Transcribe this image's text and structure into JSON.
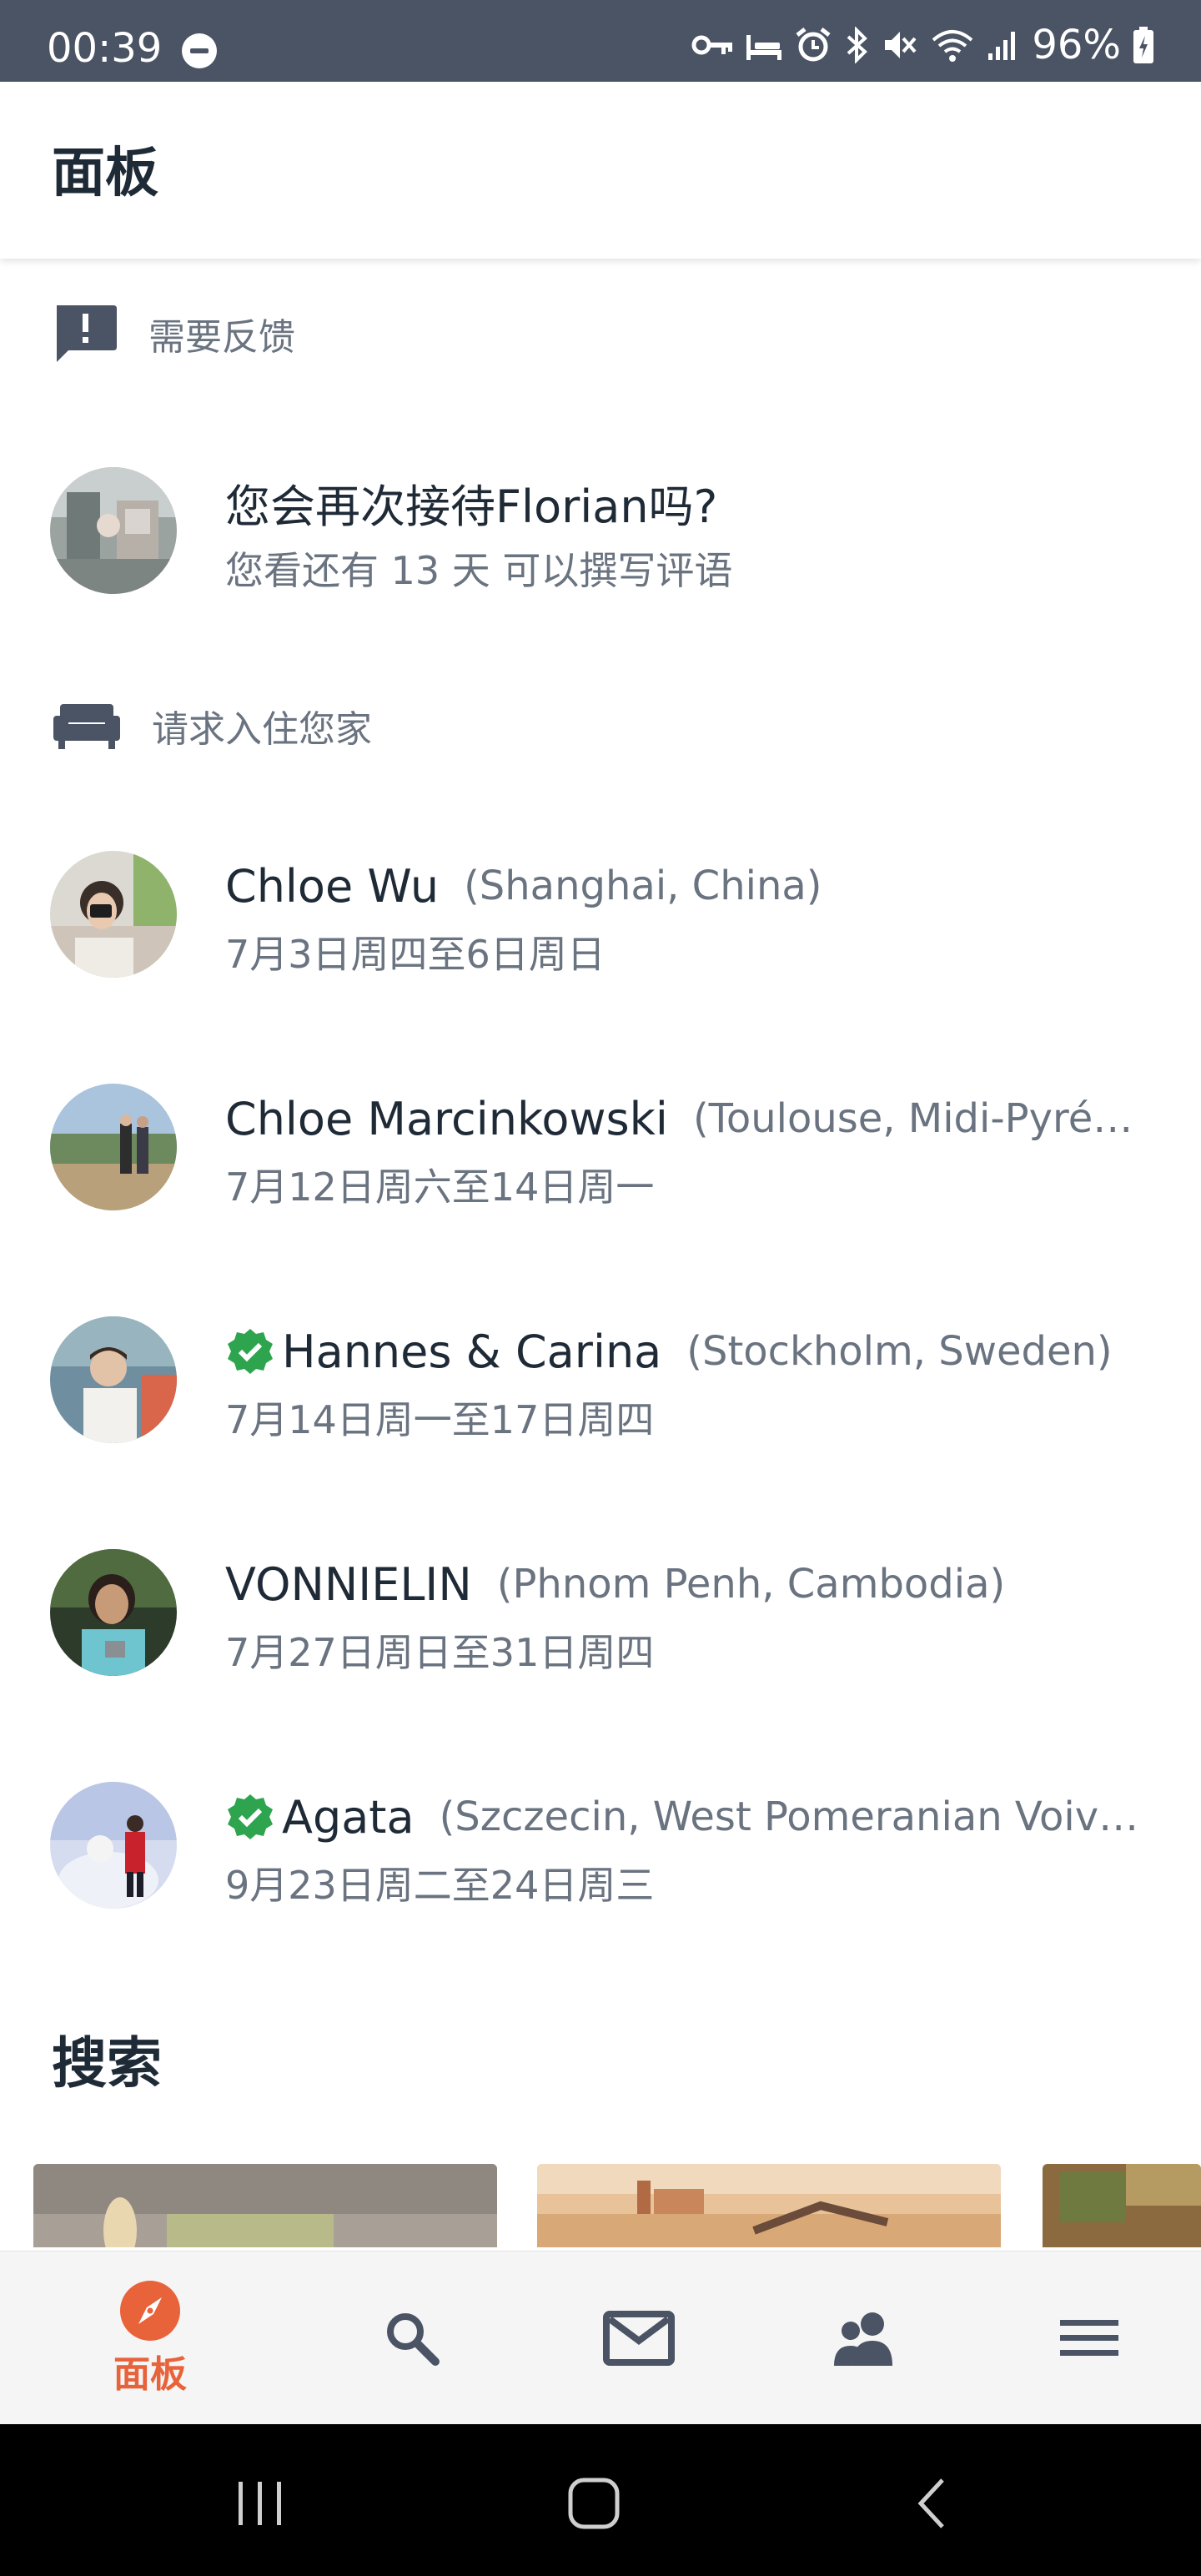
{
  "status_bar": {
    "time": "00:39",
    "battery": "96%"
  },
  "header": {
    "title": "面板"
  },
  "feedback_section": {
    "label": "需要反馈",
    "item": {
      "title": "您会再次接待Florian吗?",
      "subtitle": "您看还有 13 天 可以撰写评语"
    }
  },
  "requests_section": {
    "label": "请求入住您家",
    "items": [
      {
        "name": "Chloe Wu",
        "place": "(Shanghai, China)",
        "dates": "7月3日周四至6日周日",
        "verified": false
      },
      {
        "name": "Chloe Marcinkowski",
        "place": "(Toulouse, Midi-Pyrénées, France)",
        "dates": "7月12日周六至14日周一",
        "verified": false
      },
      {
        "name": "Hannes & Carina",
        "place": "(Stockholm, Sweden)",
        "dates": "7月14日周一至17日周四",
        "verified": true
      },
      {
        "name": "VONNIELIN",
        "place": "(Phnom Penh, Cambodia)",
        "dates": "7月27日周日至31日周四",
        "verified": false
      },
      {
        "name": "Agata",
        "place": "(Szczecin, West Pomeranian Voivodeship, Poland)",
        "dates": "9月23日周二至24日周三",
        "verified": true
      }
    ]
  },
  "search_section": {
    "heading": "搜索"
  },
  "bottom_nav": {
    "items": [
      {
        "icon": "compass-icon",
        "label": "面板",
        "active": true
      },
      {
        "icon": "search-icon",
        "label": "",
        "active": false
      },
      {
        "icon": "mail-icon",
        "label": "",
        "active": false
      },
      {
        "icon": "people-icon",
        "label": "",
        "active": false
      },
      {
        "icon": "menu-icon",
        "label": "",
        "active": false
      }
    ]
  },
  "colors": {
    "accent": "#e8623a",
    "status_bar": "#4b5464",
    "verified": "#2ea44f",
    "muted_text": "#6a7380"
  }
}
